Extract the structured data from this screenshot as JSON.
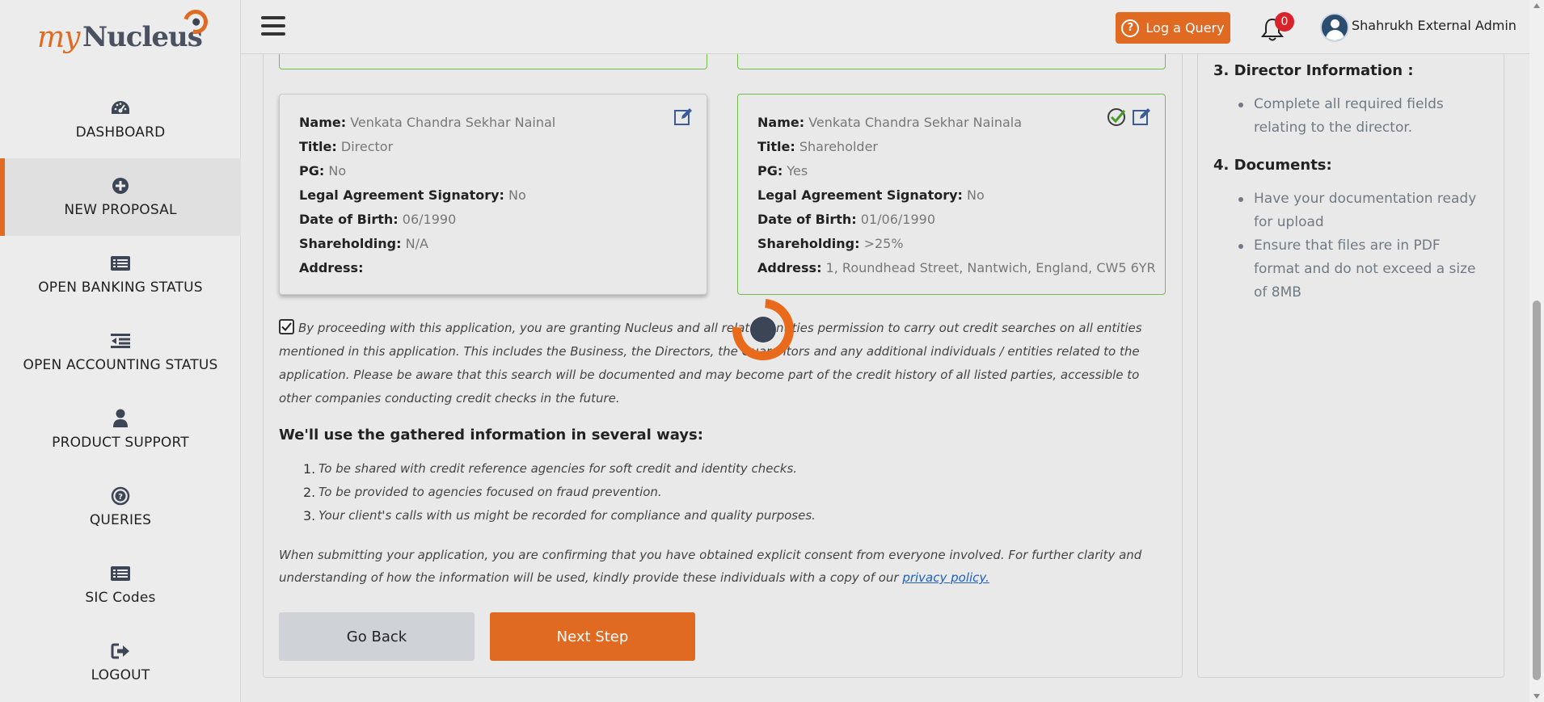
{
  "brand": {
    "my": "my",
    "nucleus": "Nucleus"
  },
  "colors": {
    "accent": "#e06a22",
    "success": "#6fbf4a",
    "notification": "#d9222a"
  },
  "sidebar": {
    "items": [
      {
        "label": "DASHBOARD",
        "icon": "dashboard-gauge-icon"
      },
      {
        "label": "NEW PROPOSAL",
        "icon": "plus-circle-icon",
        "active": true
      },
      {
        "label": "OPEN BANKING STATUS",
        "icon": "list-card-icon"
      },
      {
        "label": "OPEN ACCOUNTING STATUS",
        "icon": "indent-list-icon"
      },
      {
        "label": "PRODUCT SUPPORT",
        "icon": "user-icon"
      },
      {
        "label": "QUERIES",
        "icon": "question-circle-icon"
      },
      {
        "label": "SIC Codes",
        "icon": "list-card-icon"
      },
      {
        "label": "LOGOUT",
        "icon": "sign-out-icon"
      }
    ]
  },
  "topbar": {
    "log_query": "Log a Query",
    "notifications_count": "0",
    "user_name": "Shahrukh External Admin"
  },
  "directors": [
    {
      "name": "Venkata Chandra Sekhar Nainal",
      "title": "Director",
      "pg": "No",
      "legal_signatory": "No",
      "dob": "06/1990",
      "shareholding": "N/A",
      "address": ""
    },
    {
      "name": "Venkata Chandra Sekhar Nainala",
      "title": "Shareholder",
      "pg": "Yes",
      "legal_signatory": "No",
      "dob": "01/06/1990",
      "shareholding": ">25%",
      "address": "1, Roundhead Street, Nantwich, England, CW5 6YR"
    }
  ],
  "labels": {
    "name": "Name:",
    "title": "Title:",
    "pg": "PG:",
    "legal_signatory": "Legal Agreement Signatory:",
    "dob": "Date of Birth:",
    "shareholding": "Shareholding:",
    "address": "Address:"
  },
  "consent": {
    "checked": true,
    "text": "By proceeding with this application, you are granting Nucleus and all related entities permission to carry out credit searches on all entities mentioned in this application. This includes the Business, the Directors, the Guarantors and any additional individuals / entities related to the application. Please be aware that this search will be documented and may become part of the credit history of all listed parties, accessible to other companies conducting credit checks in the future."
  },
  "uses": {
    "heading": "We'll use the gathered information in several ways:",
    "items": [
      {
        "n": "1.",
        "text": "To be shared with credit reference agencies for soft credit and identity checks."
      },
      {
        "n": "2.",
        "text": "To be provided to agencies focused on fraud prevention."
      },
      {
        "n": "3.",
        "text": "Your client's calls with us might be recorded for compliance and quality purposes."
      }
    ]
  },
  "confirm": {
    "text": "When submitting your application, you are confirming that you have obtained explicit consent from everyone involved. For further clarity and understanding of how the information will be used, kindly provide these individuals with a copy of our ",
    "link": "privacy policy."
  },
  "buttons": {
    "back": "Go Back",
    "next": "Next Step"
  },
  "aside": {
    "sections": [
      {
        "heading": "3. Director Information :",
        "items": [
          "Complete all required fields relating to the director."
        ]
      },
      {
        "heading": "4. Documents:",
        "items": [
          "Have your documentation ready for upload",
          "Ensure that files are in PDF format and do not exceed a size of 8MB"
        ]
      }
    ]
  }
}
